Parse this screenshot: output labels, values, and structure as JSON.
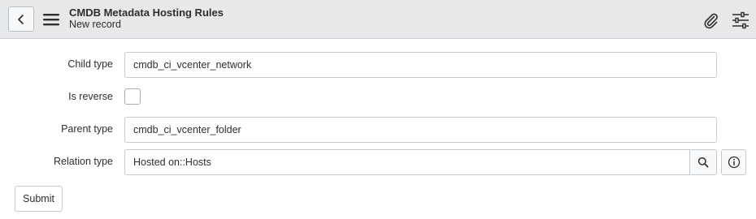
{
  "header": {
    "title": "CMDB Metadata Hosting Rules",
    "subtitle": "New record",
    "back_icon": "chevron-left-icon",
    "menu_icon": "hamburger-menu-icon",
    "attachment_icon": "paperclip-icon",
    "settings_icon": "sliders-icon"
  },
  "form": {
    "child_type": {
      "label": "Child type",
      "value": "cmdb_ci_vcenter_network"
    },
    "is_reverse": {
      "label": "Is reverse",
      "checked": false
    },
    "parent_type": {
      "label": "Parent type",
      "value": "cmdb_ci_vcenter_folder"
    },
    "relation_type": {
      "label": "Relation type",
      "value": "Hosted on::Hosts",
      "search_icon": "search-icon",
      "info_icon": "info-icon"
    },
    "submit_label": "Submit"
  },
  "colors": {
    "header_bg": "#e6e8ea",
    "border": "#c6cacd",
    "text": "#2e2e2e"
  }
}
